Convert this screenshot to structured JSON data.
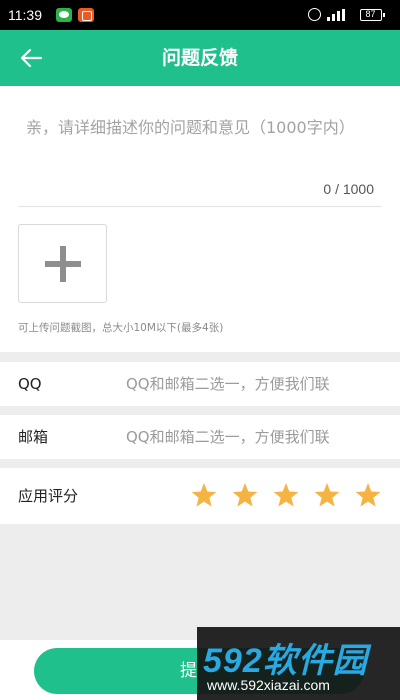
{
  "status_bar": {
    "time": "11:39",
    "battery": "87",
    "icons": [
      "wechat-icon",
      "app-notification-icon",
      "alarm-icon",
      "signal-icon",
      "battery-icon"
    ]
  },
  "header": {
    "title": "问题反馈",
    "back_icon": "arrow-left-icon"
  },
  "feedback": {
    "placeholder": "亲，请详细描述你的问题和意见（1000字内）",
    "count": "0 / 1000",
    "upload_icon": "plus-icon",
    "upload_hint": "可上传问题截图，总大小10M以下(最多4张)"
  },
  "contact": {
    "qq_label": "QQ",
    "qq_placeholder": "QQ和邮箱二选一，方便我们联",
    "email_label": "邮箱",
    "email_placeholder": "QQ和邮箱二选一，方便我们联"
  },
  "rating": {
    "label": "应用评分",
    "stars": 5,
    "max": 5,
    "star_color": "#f5b342"
  },
  "submit": {
    "label": "提"
  },
  "watermark": {
    "brand": "592软件园",
    "url": "www.592xiazai.com"
  },
  "colors": {
    "accent": "#20c08d",
    "background": "#ededed"
  }
}
